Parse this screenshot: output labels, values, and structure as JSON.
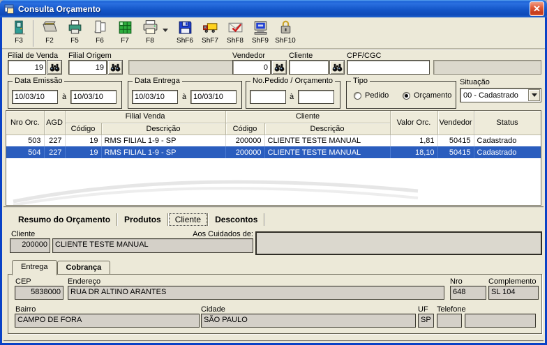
{
  "window": {
    "title": "Consulta Orçamento"
  },
  "toolbar": {
    "buttons": [
      {
        "key": "F3"
      },
      {
        "key": "F2"
      },
      {
        "key": "F5"
      },
      {
        "key": "F6"
      },
      {
        "key": "F7"
      },
      {
        "key": "F8"
      },
      {
        "key": "ShF6"
      },
      {
        "key": "ShF7"
      },
      {
        "key": "ShF8"
      },
      {
        "key": "ShF9"
      },
      {
        "key": "ShF10"
      }
    ]
  },
  "filters": {
    "filial_venda_label": "Filial de Venda",
    "filial_venda_value": "19",
    "filial_origem_label": "Filial Origem",
    "filial_origem_value": "19",
    "vendedor_label": "Vendedor",
    "vendedor_value": "0",
    "cliente_label": "Cliente",
    "cliente_value": "",
    "cpf_label": "CPF/CGC",
    "cpf_value": "",
    "data_emissao_label": "Data Emissão",
    "data_emissao_from": "10/03/10",
    "data_emissao_to": "10/03/10",
    "data_entrega_label": "Data Entrega",
    "data_entrega_from": "10/03/10",
    "data_entrega_to": "10/03/10",
    "pedido_label": "No.Pedido / Orçamento",
    "pedido_from": "",
    "pedido_to": "",
    "range_sep": "à",
    "tipo_label": "Tipo",
    "tipo_options": [
      {
        "label": "Pedido",
        "selected": false
      },
      {
        "label": "Orçamento",
        "selected": true
      }
    ],
    "situacao_label": "Situação",
    "situacao_value": "00 - Cadastrado"
  },
  "grid": {
    "header": {
      "nro": "Nro Orc.",
      "agd": "AGD",
      "filial_venda": "Filial Venda",
      "cliente": "Cliente",
      "codigo1": "Código",
      "descricao1": "Descrição",
      "codigo2": "Código",
      "descricao2": "Descrição",
      "valor": "Valor Orc.",
      "vendedor": "Vendedor",
      "status": "Status"
    },
    "rows": [
      {
        "nro": "503",
        "agd": "227",
        "fil_cod": "19",
        "fil_desc": "RMS FILIAL 1-9 - SP",
        "cli_cod": "200000",
        "cli_desc": "CLIENTE TESTE MANUAL",
        "valor": "1,81",
        "vendedor": "50415",
        "status": "Cadastrado",
        "selected": false
      },
      {
        "nro": "504",
        "agd": "227",
        "fil_cod": "19",
        "fil_desc": "RMS FILIAL 1-9 - SP",
        "cli_cod": "200000",
        "cli_desc": "CLIENTE TESTE MANUAL",
        "valor": "18,10",
        "vendedor": "50415",
        "status": "Cadastrado",
        "selected": true
      }
    ]
  },
  "tabs": [
    {
      "label": "Resumo do Orçamento",
      "selected": false
    },
    {
      "label": "Produtos",
      "selected": false
    },
    {
      "label": "Cliente",
      "selected": true
    },
    {
      "label": "Descontos",
      "selected": false
    }
  ],
  "cliente_panel": {
    "cliente_label": "Cliente",
    "cliente_codigo": "200000",
    "cliente_nome": "CLIENTE TESTE MANUAL",
    "aos_cuidados_label": "Aos Cuidados de:",
    "aos_cuidados_value": ""
  },
  "address_tabs": [
    {
      "label": "Entrega",
      "selected": true
    },
    {
      "label": "Cobrança",
      "selected": false
    }
  ],
  "address": {
    "cep_label": "CEP",
    "cep": "5838000",
    "endereco_label": "Endereço",
    "endereco": "RUA DR ALTINO ARANTES",
    "nro_label": "Nro",
    "nro": "648",
    "complemento_label": "Complemento",
    "complemento": "SL 104",
    "bairro_label": "Bairro",
    "bairro": "CAMPO DE FORA",
    "cidade_label": "Cidade",
    "cidade": "SÃO PAULO",
    "uf_label": "UF",
    "uf": "SP",
    "telefone_label": "Telefone",
    "telefone_ddd": "",
    "telefone_numero": ""
  }
}
